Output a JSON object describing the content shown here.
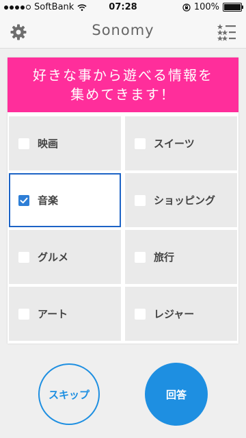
{
  "statusbar": {
    "carrier": "SoftBank",
    "time": "07:28",
    "battery": "100%",
    "battery_level": 1.0,
    "signal_bars": 4
  },
  "header": {
    "title": "Sonomy",
    "left_icon": "gear-icon",
    "right_icon": "ranking-list-icon"
  },
  "banner": {
    "line1": "好きな事から遊べる情報を",
    "line2": "集めてきます！",
    "color": "#ff2e9b"
  },
  "categories": [
    {
      "label": "映画",
      "checked": false
    },
    {
      "label": "スイーツ",
      "checked": false
    },
    {
      "label": "音楽",
      "checked": true
    },
    {
      "label": "ショッピング",
      "checked": false
    },
    {
      "label": "グルメ",
      "checked": false
    },
    {
      "label": "旅行",
      "checked": false
    },
    {
      "label": "アート",
      "checked": false
    },
    {
      "label": "レジャー",
      "checked": false
    }
  ],
  "buttons": {
    "skip": "スキップ",
    "answer": "回答"
  },
  "colors": {
    "accent": "#1e8fe1",
    "checked": "#2e7ed6",
    "selected_border": "#1c63c5",
    "banner": "#ff2e9b"
  }
}
